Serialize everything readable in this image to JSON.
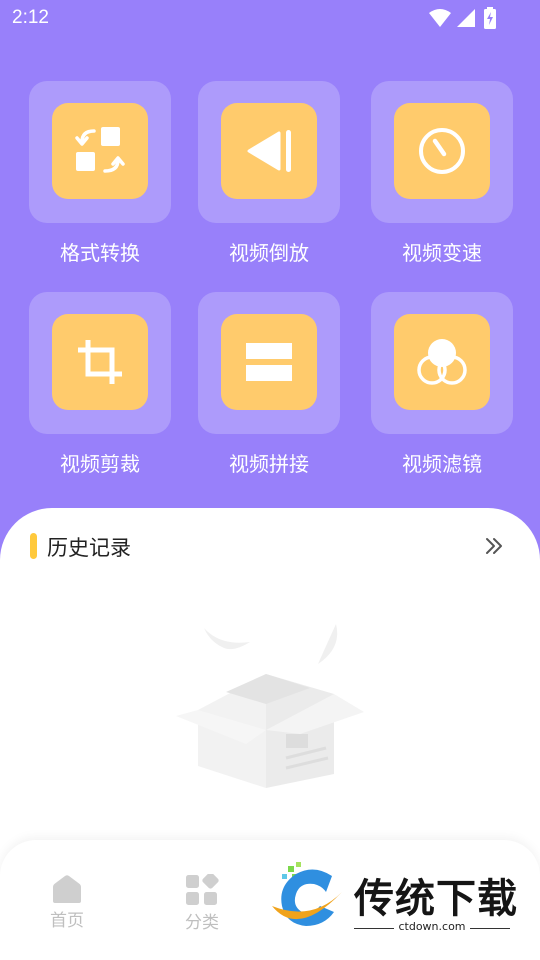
{
  "status_bar": {
    "time": "2:12"
  },
  "tools": [
    {
      "label": "格式转换",
      "icon": "format-convert-icon"
    },
    {
      "label": "视频倒放",
      "icon": "reverse-play-icon"
    },
    {
      "label": "视频变速",
      "icon": "speed-gauge-icon"
    },
    {
      "label": "视频剪裁",
      "icon": "crop-icon"
    },
    {
      "label": "视频拼接",
      "icon": "splice-icon"
    },
    {
      "label": "视频滤镜",
      "icon": "filter-icon"
    }
  ],
  "history": {
    "title": "历史记录",
    "more_icon": "double-chevron-right-icon"
  },
  "bottom_nav": [
    {
      "label": "首页",
      "icon": "home-icon"
    },
    {
      "label": "分类",
      "icon": "category-icon"
    }
  ],
  "watermark": {
    "brand": "传统下载",
    "domain": "ctdown.com"
  },
  "colors": {
    "background_top": "#9880fa",
    "tile": "#ad9bfb",
    "tile_inner": "#ffcb6c",
    "accent": "#ffc93c",
    "nav_inactive": "#bfbfbf"
  }
}
